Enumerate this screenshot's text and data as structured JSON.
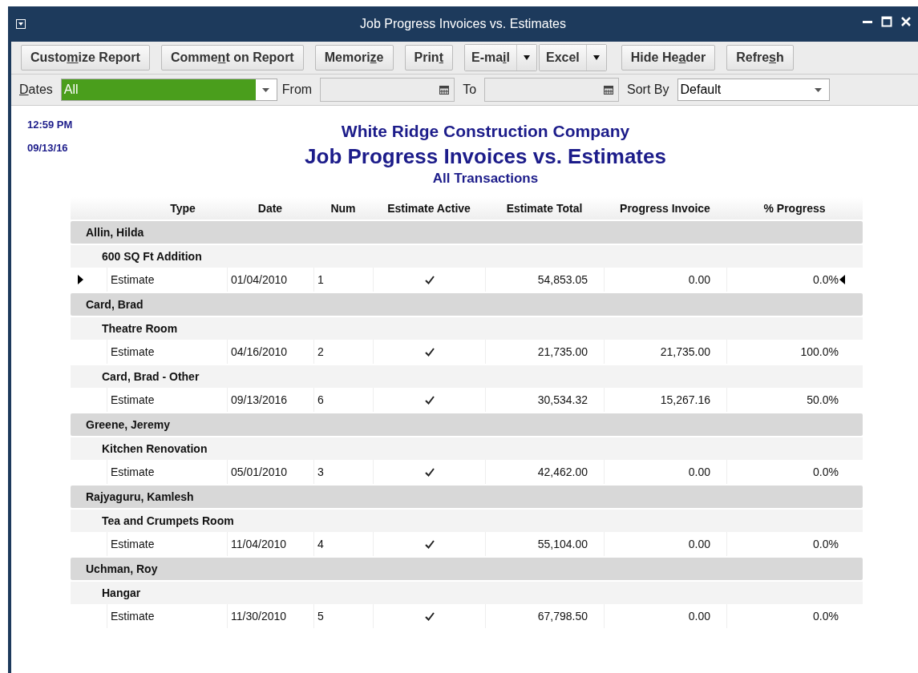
{
  "window": {
    "title": "Job Progress Invoices vs. Estimates"
  },
  "toolbar": [
    {
      "before": "Custo",
      "key": "m",
      "after": "ize Report"
    },
    {
      "before": "Comme",
      "key": "n",
      "after": "t on Report"
    },
    {
      "before": "Memori",
      "key": "z",
      "after": "e"
    },
    {
      "before": "Prin",
      "key": "t",
      "kind": "plain"
    },
    {
      "before": "E-ma",
      "key": "i",
      "after": "l",
      "kind": "menu"
    },
    {
      "before": "Excel",
      "kind": "menu"
    },
    {
      "before": "Hide He",
      "key": "a",
      "after": "der"
    },
    {
      "before": "Refre",
      "key": "s",
      "after": "h"
    }
  ],
  "filters": {
    "dates_label": {
      "key": "D",
      "after": "ates"
    },
    "dates_value": "All",
    "from_label": "From",
    "to_label": "To",
    "sort_label": "Sort By",
    "sort_value": "Default"
  },
  "report": {
    "time": "12:59 PM",
    "date": "09/13/16",
    "company": "White Ridge Construction Company",
    "title": "Job Progress Invoices vs. Estimates",
    "subtitle": "All Transactions",
    "columns": [
      "Type",
      "Date",
      "Num",
      "Estimate Active",
      "Estimate Total",
      "Progress Invoice",
      "% Progress"
    ],
    "customers": [
      {
        "name": "Allin, Hilda",
        "children": [
          {
            "name": "600 SQ Ft Addition",
            "children": [
              {
                "type": "Estimate",
                "date": "01/04/2010",
                "num": "1",
                "active": true,
                "total": "54,853.05",
                "invoice": "0.00",
                "progress": "0.0%",
                "selected": true
              }
            ]
          }
        ]
      },
      {
        "name": "Card, Brad",
        "children": [
          {
            "name": "Theatre Room",
            "children": [
              {
                "type": "Estimate",
                "date": "04/16/2010",
                "num": "2",
                "active": true,
                "total": "21,735.00",
                "invoice": "21,735.00",
                "progress": "100.0%",
                "selected": false
              }
            ]
          },
          {
            "name": "Card, Brad - Other",
            "children": [
              {
                "type": "Estimate",
                "date": "09/13/2016",
                "num": "6",
                "active": true,
                "total": "30,534.32",
                "invoice": "15,267.16",
                "progress": "50.0%",
                "selected": false
              }
            ]
          }
        ]
      },
      {
        "name": "Greene, Jeremy",
        "children": [
          {
            "name": "Kitchen Renovation",
            "children": [
              {
                "type": "Estimate",
                "date": "05/01/2010",
                "num": "3",
                "active": true,
                "total": "42,462.00",
                "invoice": "0.00",
                "progress": "0.0%",
                "selected": false
              }
            ]
          }
        ]
      },
      {
        "name": "Rajyaguru, Kamlesh",
        "children": [
          {
            "name": "Tea and Crumpets Room",
            "children": [
              {
                "type": "Estimate",
                "date": "11/04/2010",
                "num": "4",
                "active": true,
                "total": "55,104.00",
                "invoice": "0.00",
                "progress": "0.0%",
                "selected": false
              }
            ]
          }
        ]
      },
      {
        "name": "Uchman, Roy",
        "children": [
          {
            "name": "Hangar",
            "children": [
              {
                "type": "Estimate",
                "date": "11/30/2010",
                "num": "5",
                "active": true,
                "total": "67,798.50",
                "invoice": "0.00",
                "progress": "0.0%",
                "selected": false
              }
            ]
          }
        ]
      }
    ]
  }
}
